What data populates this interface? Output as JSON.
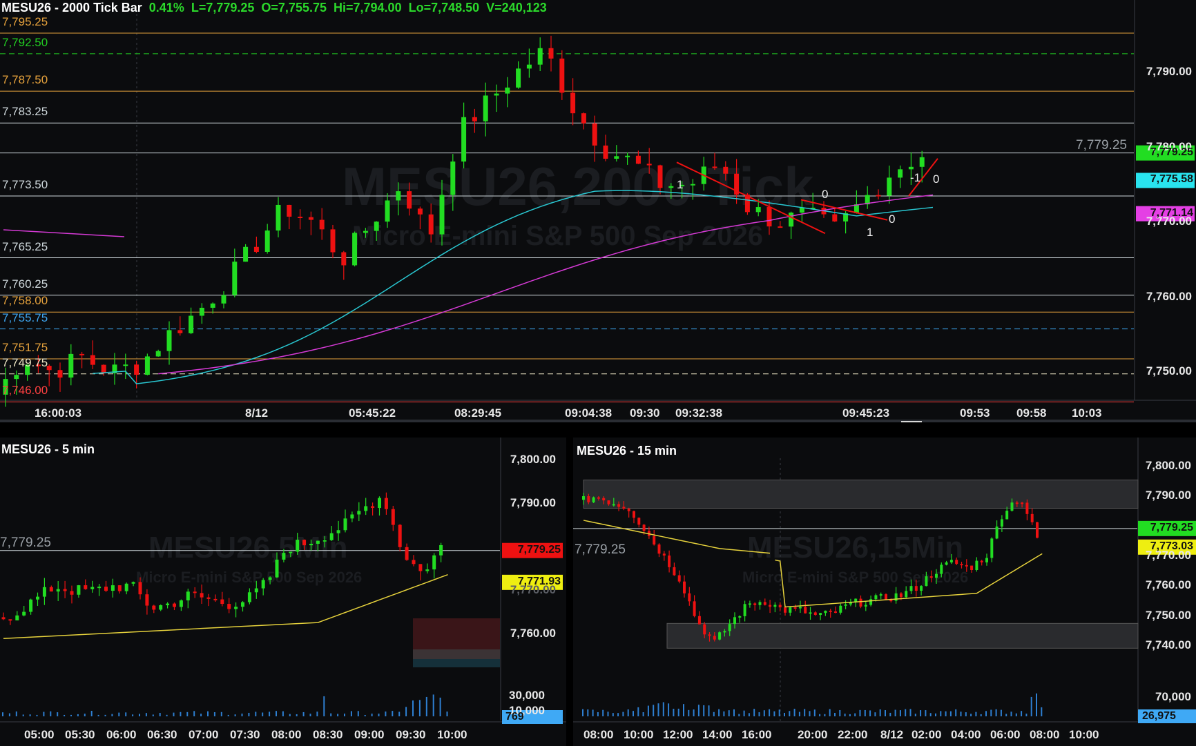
{
  "top": {
    "header": {
      "symbol": "MESU26 - 2000 Tick Bar",
      "change": "0.41%",
      "last": "L=7,779.25",
      "open": "O=7,755.75",
      "high": "Hi=7,794.00",
      "low": "Lo=7,748.50",
      "volume": "V=240,123"
    },
    "watermark": {
      "title": "MESU26,2000 Tick",
      "subtitle": "Micro E-mini S&P 500 Sep 2026"
    },
    "levels": [
      {
        "label": "7,795.25",
        "color": "#e6a23c"
      },
      {
        "label": "7,792.50",
        "color": "#22cc22"
      },
      {
        "label": "7,787.50",
        "color": "#e6a23c"
      },
      {
        "label": "7,783.25",
        "color": "#cfd8dc"
      },
      {
        "label": "7,773.50",
        "color": "#cfd8dc"
      },
      {
        "label": "7,765.25",
        "color": "#cfd8dc"
      },
      {
        "label": "7,760.25",
        "color": "#cfd8dc"
      },
      {
        "label": "7,758.00",
        "color": "#e6a23c"
      },
      {
        "label": "7,755.75",
        "color": "#3fa9f5"
      },
      {
        "label": "7,751.75",
        "color": "#e6a23c"
      },
      {
        "label": "7,749.75",
        "color": "#f1e9c8"
      },
      {
        "label": "7,746.00",
        "color": "#ff4040"
      }
    ],
    "price_axis": [
      "7,790.00",
      "7,780.00",
      "7,770.00",
      "7,760.00",
      "7,750.00"
    ],
    "last_price_line": "7,779.25",
    "price_tags": {
      "last": "7,779.25",
      "ema": "7,775.58",
      "vwap": "7,771.14"
    },
    "time_axis": [
      "16:00:03",
      "8/12",
      "05:45:22",
      "08:29:45",
      "09:04:38",
      "09:30",
      "09:32:38",
      "09:45:23",
      "09:53",
      "09:58",
      "10:03"
    ],
    "markers": [
      "1",
      "0",
      "1",
      "0",
      "-1",
      "0"
    ],
    "colors": {
      "up": "#22dd22",
      "down": "#ee1111",
      "ema": "#29c7d1",
      "vwap": "#d63ad6"
    }
  },
  "bottom_left": {
    "header": "MESU26 - 5 min",
    "watermark": {
      "title": "MESU26,5Min",
      "subtitle": "Micro E-mini S&P 500 Sep 2026"
    },
    "price_axis": [
      "7,800.00",
      "7,790.00",
      "7,780.00",
      "7,770.00",
      "7,760.00"
    ],
    "last_price_line": "7,779.25",
    "price_tags": {
      "last": "7,779.25",
      "vwap": "7,771.93"
    },
    "volume_axis": [
      "30,000",
      "10,000"
    ],
    "volume_tag": "769",
    "time_axis": [
      "05:00",
      "05:30",
      "06:00",
      "06:30",
      "07:00",
      "07:30",
      "08:00",
      "08:30",
      "09:00",
      "09:30",
      "10:00"
    ]
  },
  "bottom_right": {
    "header": "MESU26 - 15 min",
    "watermark": {
      "title": "MESU26,15Min",
      "subtitle": "Micro E-mini S&P 500 Sep 2026"
    },
    "price_axis": [
      "7,800.00",
      "7,790.00",
      "7,780.00",
      "7,770.00",
      "7,760.00",
      "7,750.00",
      "7,740.00"
    ],
    "last_price_line": "7,779.25",
    "price_tags": {
      "last": "7,779.25",
      "vwap": "7,773.03"
    },
    "volume_axis": [
      "70,000"
    ],
    "volume_tag": "26,975",
    "time_axis": [
      "08:00",
      "10:00",
      "12:00",
      "14:00",
      "16:00",
      "20:00",
      "22:00",
      "8/12",
      "02:00",
      "04:00",
      "06:00",
      "08:00",
      "10:00"
    ]
  }
}
